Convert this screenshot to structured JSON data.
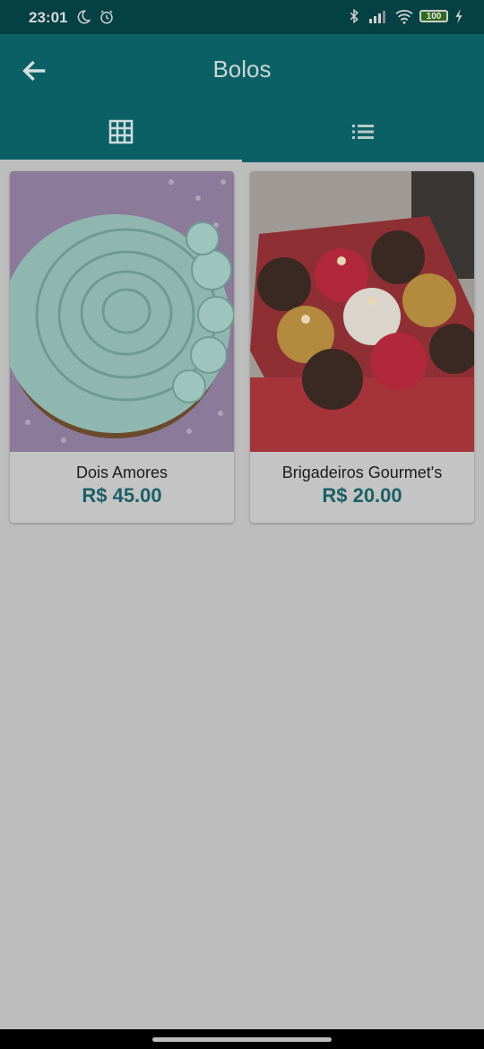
{
  "status_bar": {
    "time": "23:01",
    "battery": "100",
    "icons": [
      "moon-icon",
      "alarm-icon",
      "bluetooth-icon",
      "signal-icon",
      "wifi-icon",
      "battery-icon",
      "charging-icon"
    ]
  },
  "app_bar": {
    "title": "Bolos",
    "back_icon": "arrow-back-icon",
    "tabs": [
      {
        "icon": "grid-view-icon",
        "selected": true
      },
      {
        "icon": "list-view-icon",
        "selected": false
      }
    ],
    "color": "#0b6065"
  },
  "products": [
    {
      "name": "Dois Amores",
      "price": "R$ 45.00",
      "image": "mint-frosted-rose-cake"
    },
    {
      "name": "Brigadeiros Gourmet's",
      "price": "R$ 20.00",
      "image": "brigadeiros-gift-box"
    }
  ],
  "colors": {
    "background": "#bdbdbd",
    "price": "#1c5f66"
  }
}
